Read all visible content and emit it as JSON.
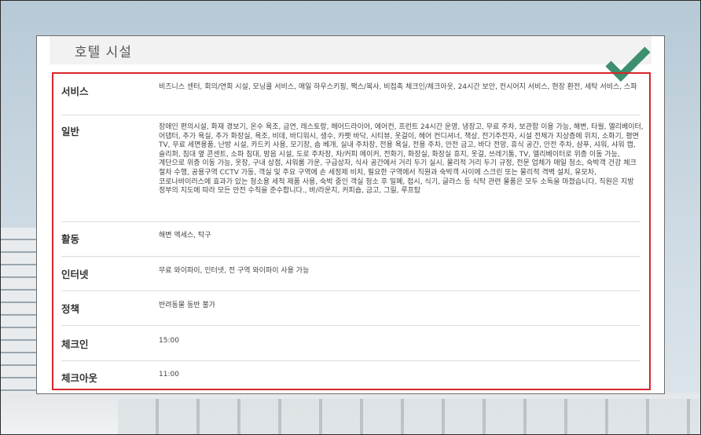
{
  "section": {
    "title": "호텔 시설"
  },
  "icons": {
    "check": "checkmark-icon",
    "check_color": "#3d8f6e"
  },
  "colors": {
    "highlight_border": "#d9262b",
    "panel_header_bg": "#f2f2f2"
  },
  "rows": [
    {
      "label": "서비스",
      "value": "비즈니스 센터, 회의/연회 시설, 모닝콜 서비스, 매일 하우스키핑, 팩스/복사, 비접촉 체크인/체크아웃, 24시간 보안, 컨시어지 서비스, 현장 환전, 세탁 서비스, 스파"
    },
    {
      "label": "일반",
      "value": "장애인 편의시설, 화재 경보기, 온수 욕조, 금연, 레스토랑, 헤어드라이어, 에어컨, 프런트 24시간 운영, 냉장고, 무료 주차, 보관함 이용 가능, 해변, 타월, 엘리베이터, 어댑터, 추가 욕실, 추가 화장실, 욕조, 비데, 바디워시, 생수, 카펫 바닥, 시티뷰, 옷걸이, 헤어 컨디셔너, 책상, 전기주전자, 시설 전체가 지상층에 위치, 소화기, 평면 TV, 무료 세면용품, 난방 시설, 카드키 사용, 모기장, 솜 베개, 실내 주차장, 전용 욕실, 전용 주차, 안전 금고, 바다 전망, 휴식 공간, 안전 주차, 샴푸, 샤워, 샤워 캡, 슬리퍼, 침대 옆 콘센트, 소파 침대, 방음 시설, 도로 주차장, 차/커피 메이커, 전화기, 화장실, 화장실 휴지, 옷걸, 쓰레기통, TV, 엘리베이터로 위층 이동 가능, 계단으로 위층 이동 가능, 옷장, 구내 상점, 샤워룸 가운, 구급상자, 식사 공간에서 거리 두기 실시, 물리적 거리 두기 규정, 전문 업체가 매일 청소, 숙박객 건강 체크 절차 수행, 공용구역 CCTV 가동, 객실 및 주요 구역에 손 세정제 비치, 필요한 구역에서 직원과 숙박객 사이에 스크린 또는 물리적 격벽 설치, 유모차, 코로나바이러스에 효과가 있는 청소용 세척 제품 사용, 숙박 중인 객실 청소 후 밀폐, 접시, 식기, 글라스 등 식탁 관련 물품은 모두 소독을 마쳤습니다, 직원은 지방 정부의 지도에 따라 모든 안전 수칙을 준수합니다., 바/라운지, 커피숍, 금고, 그릴, 루프탑"
    },
    {
      "label": "활동",
      "value": "해변 액세스, 탁구"
    },
    {
      "label": "인터넷",
      "value": "무료 와이파이, 인터넷, 전 구역 와이파이 사용 가능"
    },
    {
      "label": "정책",
      "value": "반려동물 동반 불가"
    },
    {
      "label": "체크인",
      "value": "15:00"
    },
    {
      "label": "체크아웃",
      "value": "11:00"
    }
  ]
}
